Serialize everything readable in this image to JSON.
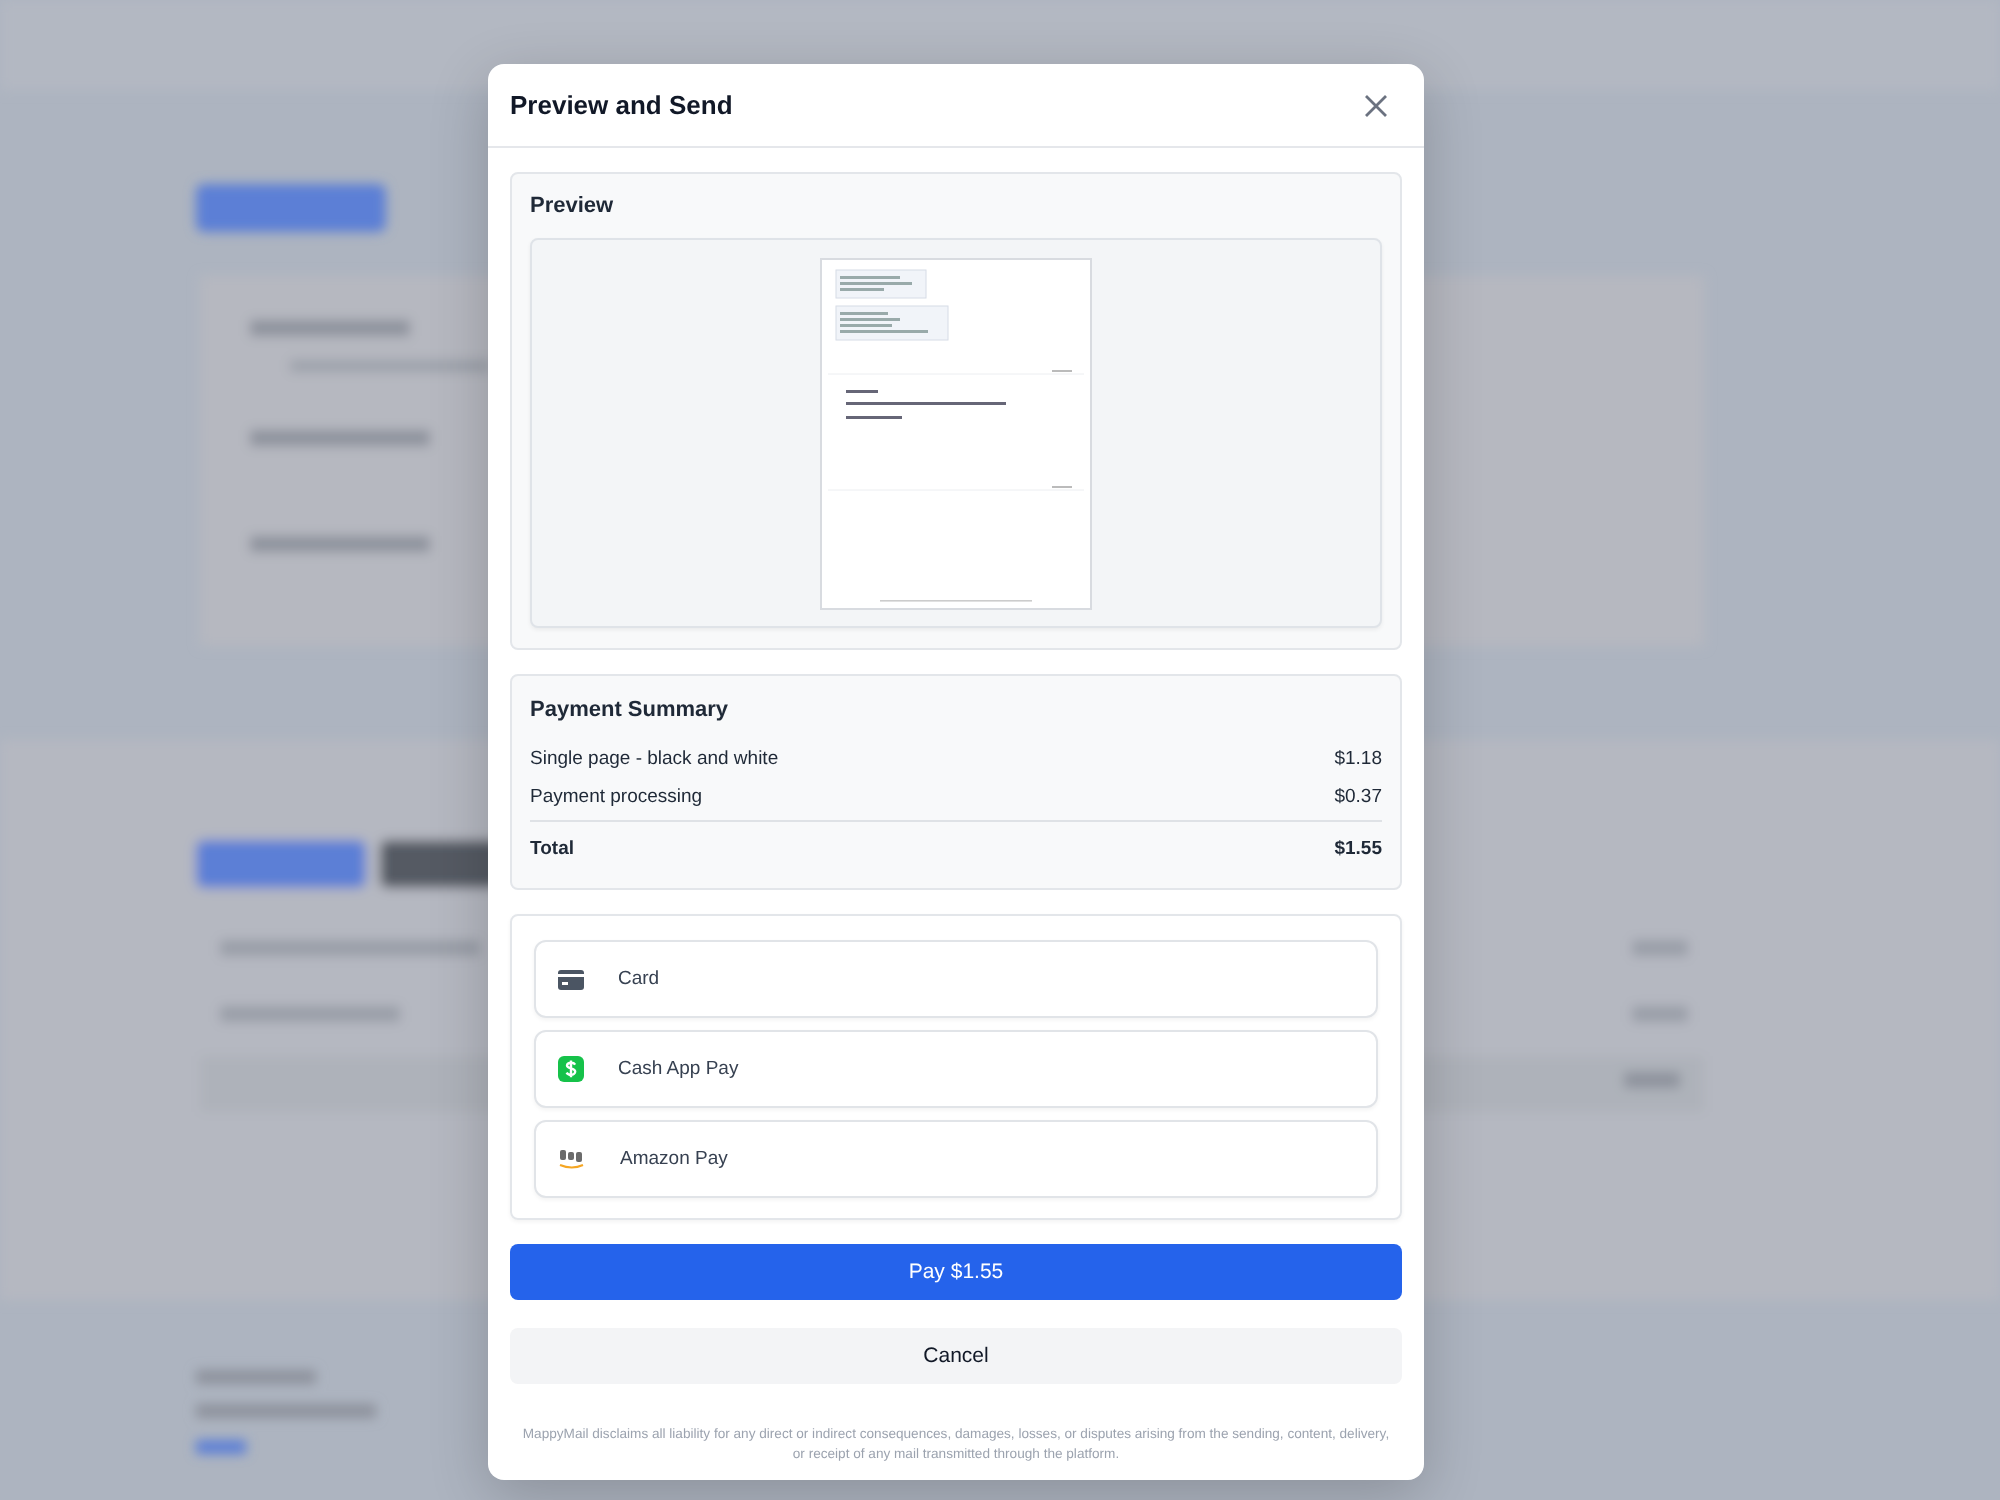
{
  "dialog": {
    "title": "Preview and Send"
  },
  "preview": {
    "heading": "Preview"
  },
  "payment_summary": {
    "heading": "Payment Summary",
    "lines": [
      {
        "kind": "item",
        "label": "Single page - black and white",
        "amount": "$1.18"
      },
      {
        "kind": "item",
        "label": "Payment processing",
        "amount": "$0.37"
      },
      {
        "kind": "total",
        "label": "Total",
        "amount": "$1.55"
      }
    ]
  },
  "payment_methods": [
    {
      "kind": "card",
      "label": "Card"
    },
    {
      "kind": "cashapp",
      "label": "Cash App Pay"
    },
    {
      "kind": "amazon",
      "label": "Amazon Pay"
    }
  ],
  "pay_button": "Pay $1.55",
  "cancel_button": "Cancel",
  "disclaimer": "MappyMail disclaims all liability for any direct or indirect consequences, damages, losses, or disputes arising from the sending, content, delivery, or receipt of any mail transmitted through the platform."
}
